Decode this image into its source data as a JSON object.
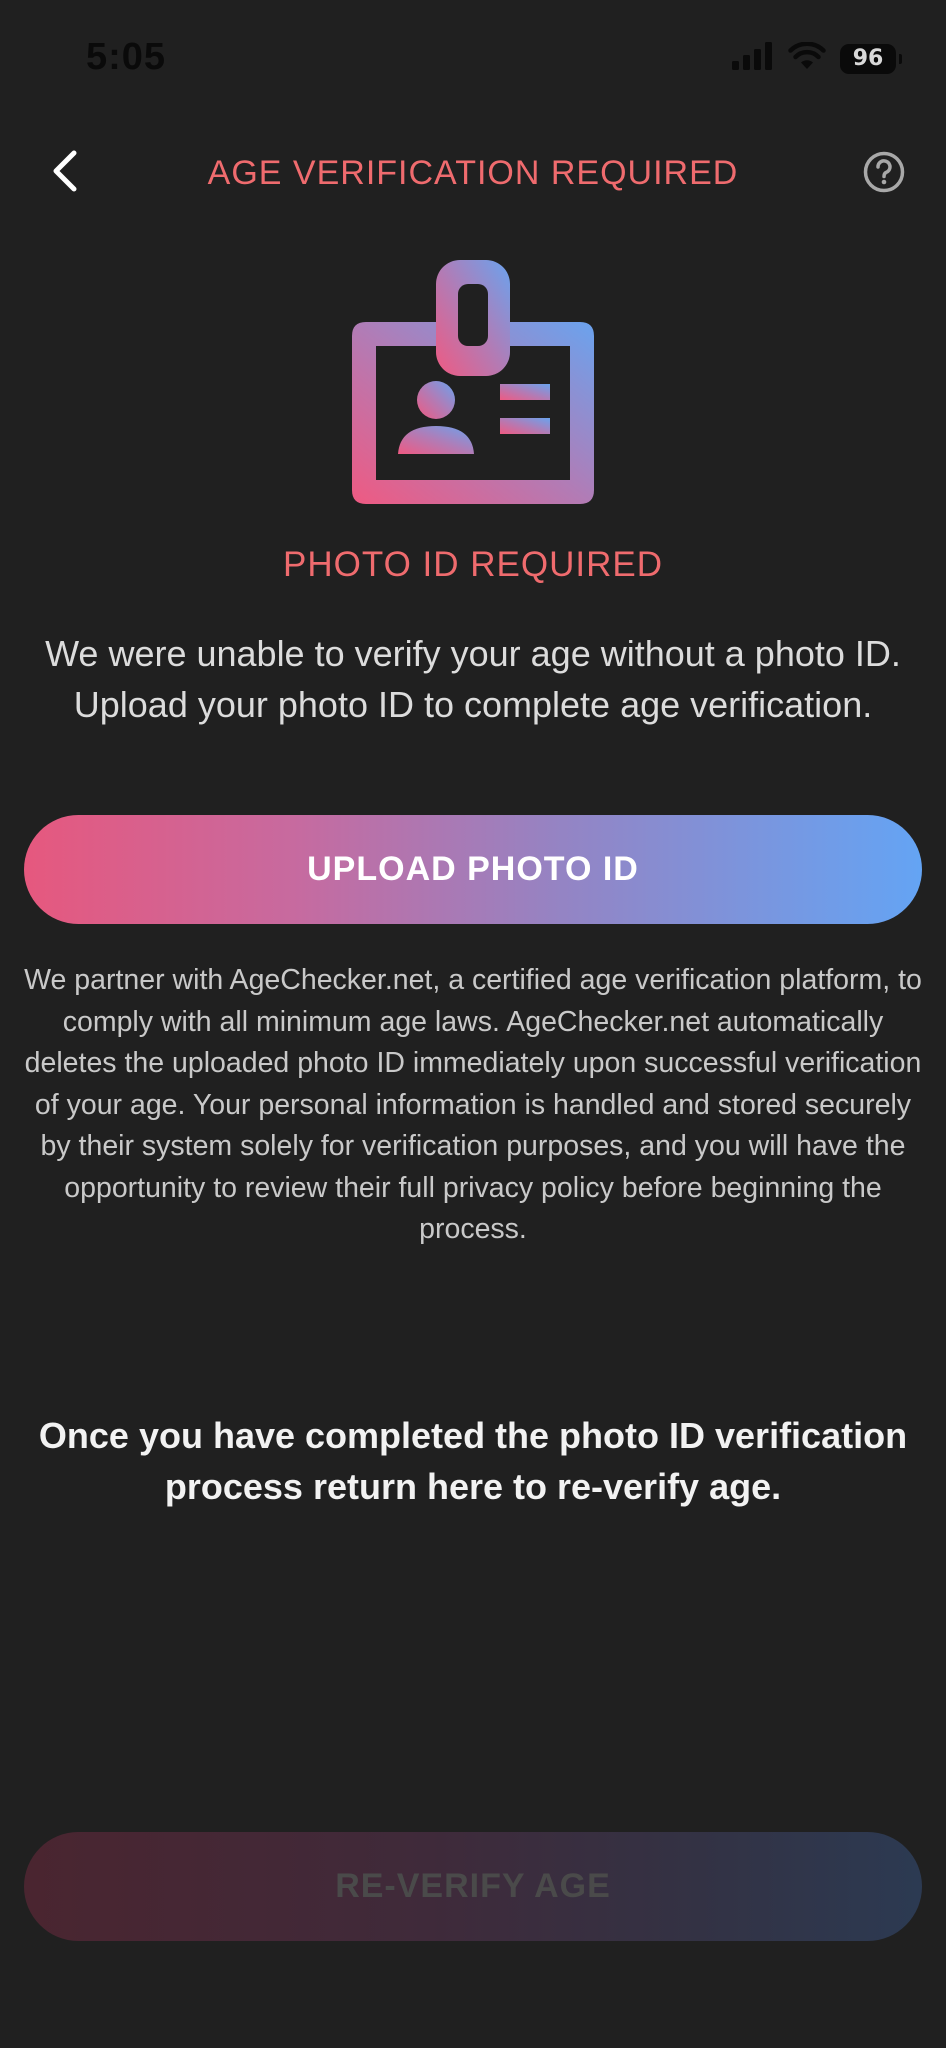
{
  "status_bar": {
    "time": "5:05",
    "battery": "96",
    "icons": [
      "cellular-signal-icon",
      "wifi-icon",
      "battery-icon"
    ]
  },
  "header": {
    "title": "AGE VERIFICATION REQUIRED",
    "back_icon": "chevron-left-icon",
    "help_icon": "question-circle-icon"
  },
  "hero": {
    "icon": "id-badge-icon"
  },
  "content": {
    "section_title": "PHOTO ID REQUIRED",
    "intro": "We were unable to verify your age without a photo ID. Upload your photo ID to complete age verification.",
    "upload_label": "UPLOAD PHOTO ID",
    "disclaimer": "We partner with AgeChecker.net, a certified age verification platform, to comply with all minimum age laws. AgeChecker.net automatically deletes the uploaded photo ID immediately upon successful verification of your age. Your personal information is handled and stored securely by their system solely for verification purposes, and you will have the opportunity to review their full privacy policy before beginning the process.",
    "return_note": "Once you have completed the photo ID verification process return here to re-verify age.",
    "reverify_label": "RE-VERIFY AGE"
  },
  "colors": {
    "background": "#202020",
    "accent_red": "#ef6b6e",
    "gradient_start": "#e6587e",
    "gradient_end": "#64a4f4"
  }
}
